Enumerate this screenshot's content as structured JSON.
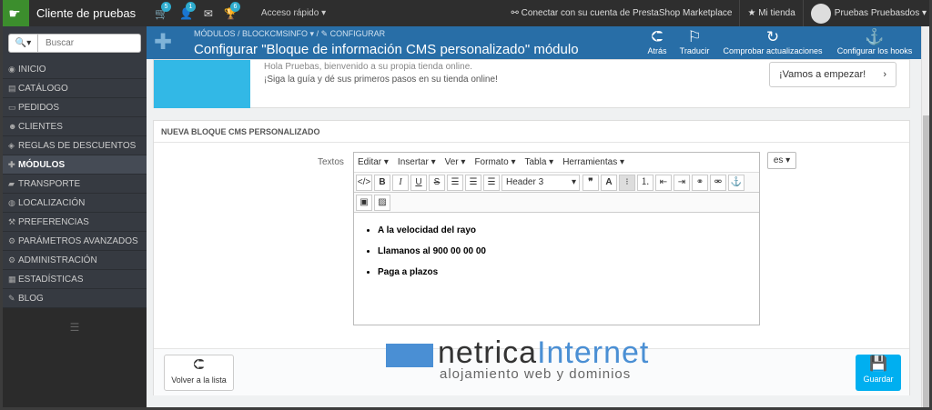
{
  "topbar": {
    "shop_name": "Cliente de pruebas",
    "badges": {
      "orders": "5",
      "customers": "1",
      "messages": "",
      "trophy": "6"
    },
    "quick_access": "Acceso rápido ▾",
    "marketplace": "Conectar con su cuenta de PrestaShop Marketplace",
    "my_shop": "Mi tienda",
    "user": "Pruebas Pruebasdos ▾"
  },
  "sidebar": {
    "search_placeholder": "Buscar",
    "items": [
      {
        "label": "INICIO"
      },
      {
        "label": "CATÁLOGO"
      },
      {
        "label": "PEDIDOS"
      },
      {
        "label": "CLIENTES"
      },
      {
        "label": "REGLAS DE DESCUENTOS"
      },
      {
        "label": "MÓDULOS"
      },
      {
        "label": "TRANSPORTE"
      },
      {
        "label": "LOCALIZACIÓN"
      },
      {
        "label": "PREFERENCIAS"
      },
      {
        "label": "PARÁMETROS AVANZADOS"
      },
      {
        "label": "ADMINISTRACIÓN"
      },
      {
        "label": "ESTADÍSTICAS"
      },
      {
        "label": "BLOG"
      }
    ]
  },
  "header": {
    "breadcrumb": [
      "MÓDULOS",
      "BLOCKCMSINFO ▾",
      "CONFIGURAR"
    ],
    "title": "Configurar \"Bloque de información CMS personalizado\" módulo",
    "tools": {
      "back": "Atrás",
      "translate": "Traducir",
      "check_updates": "Comprobar actualizaciones",
      "hooks": "Configurar los hooks"
    }
  },
  "welcome": {
    "line1": "Hola Pruebas, bienvenido a su propia tienda online.",
    "line2": "¡Siga la guía y dé sus primeros pasos en su tienda online!",
    "start_button": "¡Vamos a empezar!"
  },
  "panel": {
    "heading": "NUEVA BLOQUE CMS PERSONALIZADO",
    "field_label": "Textos",
    "menus": [
      "Editar ▾",
      "Insertar ▾",
      "Ver ▾",
      "Formato ▾",
      "Tabla ▾",
      "Herramientas ▾"
    ],
    "format_select": "Header 3",
    "items": [
      "A la velocidad del rayo",
      "Llamanos al 900 00 00 00",
      "Paga a plazos"
    ],
    "lang": "es ▾",
    "back_button": "Volver a la lista",
    "save_button": "Guardar"
  },
  "watermark": {
    "word1": "netrica",
    "word2": "Internet",
    "subtitle": "alojamiento web y dominios"
  }
}
